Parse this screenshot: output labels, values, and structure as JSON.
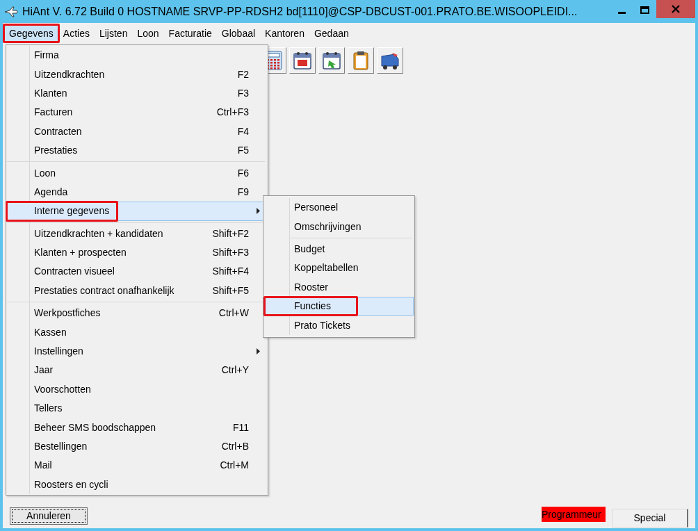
{
  "window": {
    "title": "HiAnt V. 6.72 Build 0 HOSTNAME SRVP-PP-RDSH2 bd[1110]@CSP-DBCUST-001.PRATO.BE.WISOOPLEIDI..."
  },
  "menu_bar": [
    {
      "label": "Gegevens",
      "selected": true,
      "highlighted": true
    },
    {
      "label": "Acties",
      "selected": false,
      "highlighted": false
    },
    {
      "label": "Lijsten",
      "selected": false,
      "highlighted": false
    },
    {
      "label": "Loon",
      "selected": false,
      "highlighted": false
    },
    {
      "label": "Facturatie",
      "selected": false,
      "highlighted": false
    },
    {
      "label": "Globaal",
      "selected": false,
      "highlighted": false
    },
    {
      "label": "Kantoren",
      "selected": false,
      "highlighted": false
    },
    {
      "label": "Gedaan",
      "selected": false,
      "highlighted": false
    }
  ],
  "menu": {
    "sections": [
      [
        {
          "label": "Firma",
          "selected": false,
          "highlighted": false,
          "has_submenu": false
        },
        {
          "label": "Uitzendkrachten",
          "shortcut": "F2",
          "selected": false,
          "highlighted": false,
          "has_submenu": false
        },
        {
          "label": "Klanten",
          "shortcut": "F3",
          "selected": false,
          "highlighted": false,
          "has_submenu": false
        },
        {
          "label": "Facturen",
          "shortcut": "Ctrl+F3",
          "selected": false,
          "highlighted": false,
          "has_submenu": false
        },
        {
          "label": "Contracten",
          "shortcut": "F4",
          "selected": false,
          "highlighted": false,
          "has_submenu": false
        },
        {
          "label": "Prestaties",
          "shortcut": "F5",
          "selected": false,
          "highlighted": false,
          "has_submenu": false
        }
      ],
      [
        {
          "label": "Loon",
          "shortcut": "F6",
          "selected": false,
          "highlighted": false,
          "has_submenu": false
        },
        {
          "label": "Agenda",
          "shortcut": "F9",
          "selected": false,
          "highlighted": false,
          "has_submenu": false
        },
        {
          "label": "Interne gegevens",
          "selected": true,
          "highlighted": true,
          "has_submenu": true
        }
      ],
      [
        {
          "label": "Uitzendkrachten + kandidaten",
          "shortcut": "Shift+F2",
          "selected": false,
          "highlighted": false,
          "has_submenu": false
        },
        {
          "label": "Klanten + prospecten",
          "shortcut": "Shift+F3",
          "selected": false,
          "highlighted": false,
          "has_submenu": false
        },
        {
          "label": "Contracten visueel",
          "shortcut": "Shift+F4",
          "selected": false,
          "highlighted": false,
          "has_submenu": false
        },
        {
          "label": "Prestaties contract onafhankelijk",
          "shortcut": "Shift+F5",
          "selected": false,
          "highlighted": false,
          "has_submenu": false
        }
      ],
      [
        {
          "label": "Werkpostfiches",
          "shortcut": "Ctrl+W",
          "selected": false,
          "highlighted": false,
          "has_submenu": false
        },
        {
          "label": "Kassen",
          "selected": false,
          "highlighted": false,
          "has_submenu": false
        },
        {
          "label": "Instellingen",
          "selected": false,
          "highlighted": false,
          "has_submenu": true
        },
        {
          "label": "Jaar",
          "shortcut": "Ctrl+Y",
          "selected": false,
          "highlighted": false,
          "has_submenu": false
        },
        {
          "label": "Voorschotten",
          "selected": false,
          "highlighted": false,
          "has_submenu": false
        },
        {
          "label": "Tellers",
          "selected": false,
          "highlighted": false,
          "has_submenu": false
        },
        {
          "label": "Beheer SMS boodschappen",
          "shortcut": "F11",
          "selected": false,
          "highlighted": false,
          "has_submenu": false
        },
        {
          "label": "Bestellingen",
          "shortcut": "Ctrl+B",
          "selected": false,
          "highlighted": false,
          "has_submenu": false
        },
        {
          "label": "Mail",
          "shortcut": "Ctrl+M",
          "selected": false,
          "highlighted": false,
          "has_submenu": false
        },
        {
          "label": "Roosters en cycli",
          "selected": false,
          "highlighted": false,
          "has_submenu": false
        }
      ]
    ]
  },
  "submenu": {
    "sections": [
      [
        {
          "label": "Personeel",
          "selected": false,
          "highlighted": false
        },
        {
          "label": "Omschrijvingen",
          "selected": false,
          "highlighted": false
        }
      ],
      [
        {
          "label": "Budget",
          "selected": false,
          "highlighted": false
        },
        {
          "label": "Koppeltabellen",
          "selected": false,
          "highlighted": false
        },
        {
          "label": "Rooster",
          "selected": false,
          "highlighted": false
        },
        {
          "label": "Functies",
          "selected": true,
          "highlighted": true
        },
        {
          "label": "Prato Tickets",
          "selected": false,
          "highlighted": false
        }
      ]
    ]
  },
  "footer": {
    "cancel_button": "Annuleren",
    "role_badge": "Programmeur",
    "special_button": "Special"
  }
}
